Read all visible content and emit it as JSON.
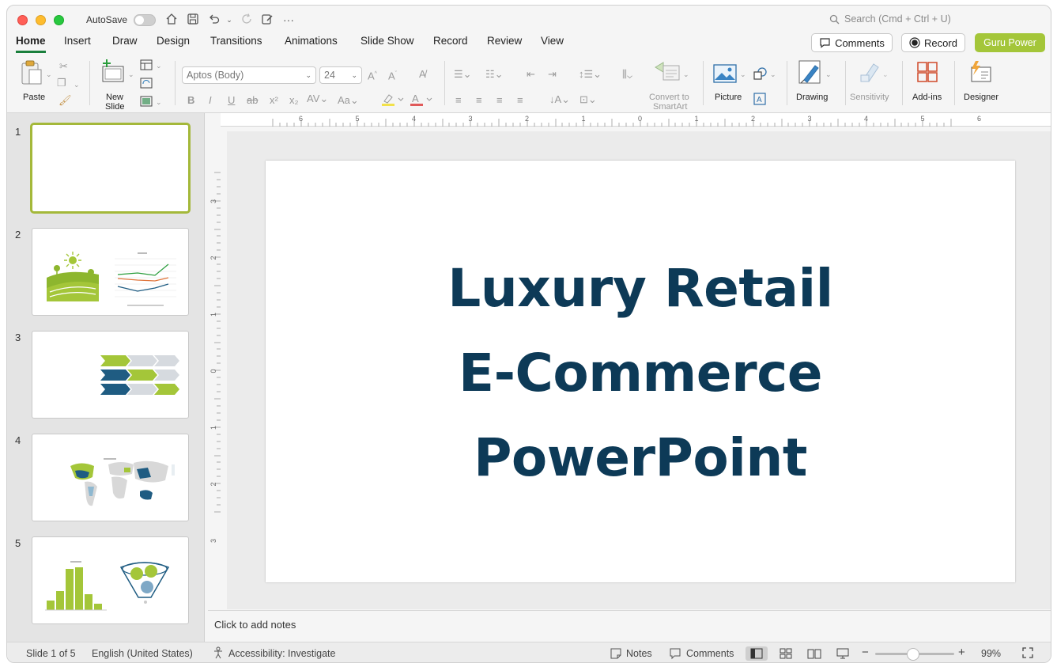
{
  "titlebar": {
    "autosave_label": "AutoSave",
    "search_placeholder": "Search (Cmd + Ctrl + U)"
  },
  "tabs": [
    "Home",
    "Insert",
    "Draw",
    "Design",
    "Transitions",
    "Animations",
    "Slide Show",
    "Record",
    "Review",
    "View"
  ],
  "header_buttons": {
    "comments": "Comments",
    "record": "Record",
    "guru": "Guru Power"
  },
  "ribbon": {
    "paste": "Paste",
    "new_slide_1": "New",
    "new_slide_2": "Slide",
    "font_name": "Aptos (Body)",
    "font_size": "24",
    "convert_1": "Convert to",
    "convert_2": "SmartArt",
    "picture": "Picture",
    "drawing": "Drawing",
    "sensitivity": "Sensitivity",
    "addins": "Add-ins",
    "designer": "Designer"
  },
  "slides": [
    "1",
    "2",
    "3",
    "4",
    "5"
  ],
  "slide": {
    "line1": "Luxury Retail",
    "line2": "E-Commerce",
    "line3": "PowerPoint"
  },
  "notes_placeholder": "Click to add notes",
  "status": {
    "slide_of": "Slide 1 of 5",
    "language": "English (United States)",
    "accessibility": "Accessibility: Investigate",
    "notes": "Notes",
    "comments": "Comments",
    "zoom": "99%"
  },
  "colors": {
    "title_text": "#0d3a57",
    "accent_green": "#a4c639",
    "dark_blue": "#1f5c82"
  },
  "ruler_numbers": [
    "6",
    "5",
    "4",
    "3",
    "2",
    "1",
    "0",
    "1",
    "2",
    "3",
    "4",
    "5",
    "6"
  ],
  "vruler_numbers": [
    "3",
    "2",
    "1",
    "0",
    "1",
    "2",
    "3"
  ]
}
